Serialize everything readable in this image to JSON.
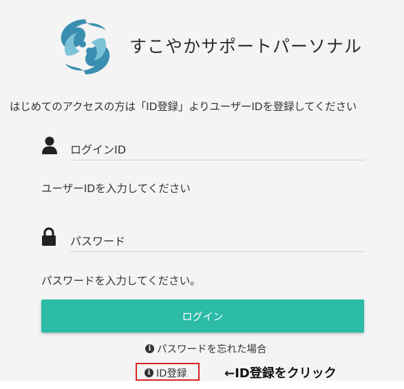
{
  "brand": {
    "title": "すこやかサポートパーソナル",
    "logo_icon": "swirl-figures-logo",
    "logo_colors": [
      "#3a8fb0",
      "#7cc3d8"
    ]
  },
  "intro_text": "はじめてのアクセスの方は「ID登録」よりユーザーIDを登録してください",
  "login_id": {
    "icon": "user-icon",
    "placeholder": "ログインID",
    "value": "",
    "help": "ユーザーIDを入力してください"
  },
  "password": {
    "icon": "lock-icon",
    "placeholder": "パスワード",
    "value": "",
    "help": "パスワードを入力してください。"
  },
  "login_button": {
    "label": "ログイン",
    "color": "#2bbba7"
  },
  "forgot_password_link": {
    "icon": "info-circle-icon",
    "label": "パスワードを忘れた場合"
  },
  "register_link": {
    "icon": "info-circle-icon",
    "label": "ID登録"
  },
  "annotation": {
    "text": "←ID登録をクリック",
    "highlight_color": "#d92020"
  }
}
